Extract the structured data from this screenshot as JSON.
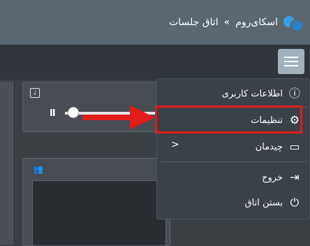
{
  "header": {
    "brand_name": "اسکای‌روم",
    "separator": "»",
    "room_name": "اتاق جلسات"
  },
  "player": {
    "pause_symbol": "II"
  },
  "menu": {
    "items": [
      {
        "label": "اطلاعات کاربری",
        "icon": "info-icon"
      },
      {
        "label": "تنظیمات",
        "icon": "gear-icon"
      },
      {
        "label": "چیدمان",
        "icon": "layout-icon",
        "submenu_indicator": "<"
      },
      {
        "label": "خروج",
        "icon": "exit-icon"
      },
      {
        "label": "بستن اتاق",
        "icon": "power-icon"
      }
    ]
  },
  "colors": {
    "topbar": "#5a6670",
    "menu_bg": "#3b4148",
    "highlight": "#e21b1b",
    "hamburger": "#a3b1bd"
  }
}
